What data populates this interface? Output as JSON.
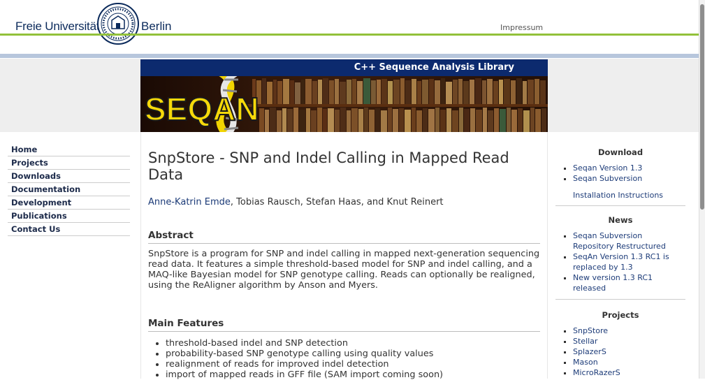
{
  "header": {
    "university_left": "Freie Universität",
    "university_right": "Berlin",
    "impressum": "Impressum",
    "banner_tagline": "C++ Sequence Analysis Library",
    "logo_text": "SEQAN"
  },
  "nav": {
    "items": [
      {
        "label": "Home"
      },
      {
        "label": "Projects"
      },
      {
        "label": "Downloads"
      },
      {
        "label": "Documentation"
      },
      {
        "label": "Development"
      },
      {
        "label": "Publications"
      },
      {
        "label": "Contact Us"
      }
    ]
  },
  "main": {
    "title": "SnpStore - SNP and Indel Calling in Mapped Read Data",
    "author_link": "Anne-Katrin Emde",
    "authors_rest": ", Tobias Rausch, Stefan Haas, and Knut Reinert",
    "abstract_title": "Abstract",
    "abstract_text": "SnpStore is a program for SNP and indel calling in mapped next-generation sequencing read data. It features a simple threshold-based model for SNP and indel calling, and a MAQ-like Bayesian model for SNP genotype calling. Reads can optionally be realigned, using the ReAligner algorithm by Anson and Myers.",
    "features_title": "Main Features",
    "features": [
      "threshold-based indel and SNP detection",
      "probability-based SNP genotype calling using quality values",
      "realignment of reads for improved indel detection",
      "import of mapped reads in GFF file (SAM import coming soon)"
    ]
  },
  "sidebar": {
    "download_title": "Download",
    "download_items": [
      "Seqan Version 1.3",
      "Seqan Subversion"
    ],
    "install_link": "Installation Instructions",
    "news_title": "News",
    "news_items": [
      "Seqan Subversion Repository Restructured",
      "SeqAn Version 1.3 RC1 is replaced by 1.3",
      "New version 1.3 RC1 released"
    ],
    "projects_title": "Projects",
    "project_items": [
      "SnpStore",
      "Stellar",
      "SplazerS",
      "Mason",
      "MicroRazerS"
    ]
  },
  "colors": {
    "accent_green": "#92c13a",
    "navy": "#0c2a6e",
    "link": "#1c3b78"
  }
}
